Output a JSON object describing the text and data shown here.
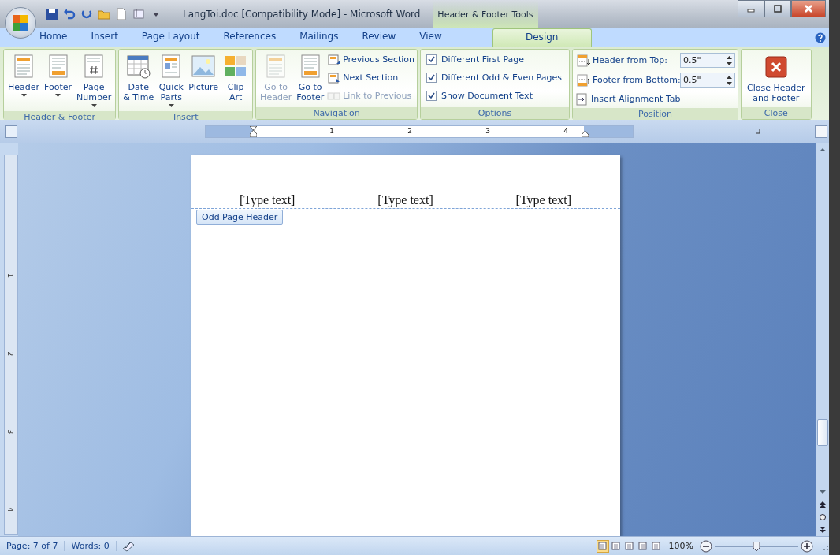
{
  "window": {
    "title": "LangToi.doc [Compatibility Mode] - Microsoft Word",
    "context_group": "Header & Footer Tools"
  },
  "tabs": [
    {
      "label": "Home",
      "selected": false
    },
    {
      "label": "Insert",
      "selected": false
    },
    {
      "label": "Page Layout",
      "selected": false
    },
    {
      "label": "References",
      "selected": false
    },
    {
      "label": "Mailings",
      "selected": false
    },
    {
      "label": "Review",
      "selected": false
    },
    {
      "label": "View",
      "selected": false
    },
    {
      "label": "Design",
      "selected": true,
      "kind": "context"
    }
  ],
  "ribbon": [
    {
      "label": "Header & Footer",
      "items": [
        {
          "kind": "large",
          "label": "Header",
          "dropdown": true,
          "disabled": false
        },
        {
          "kind": "large",
          "label": "Footer",
          "dropdown": true,
          "disabled": false
        },
        {
          "kind": "large",
          "label": "Page\nNumber",
          "dropdown": true,
          "disabled": false
        }
      ]
    },
    {
      "label": "Insert",
      "items": [
        {
          "kind": "large",
          "label": "Date\n& Time",
          "dropdown": false,
          "disabled": false
        },
        {
          "kind": "large",
          "label": "Quick\nParts",
          "dropdown": true,
          "disabled": false
        },
        {
          "kind": "large",
          "label": "Picture",
          "dropdown": false,
          "disabled": false
        },
        {
          "kind": "large",
          "label": "Clip\nArt",
          "dropdown": false,
          "disabled": false
        }
      ]
    },
    {
      "label": "Navigation",
      "items": [
        {
          "kind": "large",
          "label": "Go to\nHeader",
          "dropdown": false,
          "disabled": true
        },
        {
          "kind": "large",
          "label": "Go to\nFooter",
          "dropdown": false,
          "disabled": false
        },
        {
          "kind": "stack",
          "rows": [
            {
              "kind": "small",
              "label": "Previous Section",
              "disabled": false
            },
            {
              "kind": "small",
              "label": "Next Section",
              "disabled": false
            },
            {
              "kind": "small",
              "label": "Link to Previous",
              "disabled": true
            }
          ]
        }
      ]
    },
    {
      "label": "Options",
      "items": [
        {
          "kind": "stack",
          "rows": [
            {
              "kind": "checkbox",
              "label": "Different First Page",
              "checked": true
            },
            {
              "kind": "checkbox",
              "label": "Different Odd & Even Pages",
              "checked": true
            },
            {
              "kind": "checkbox",
              "label": "Show Document Text",
              "checked": true
            }
          ]
        }
      ]
    },
    {
      "label": "Position",
      "items": [
        {
          "kind": "stack",
          "rows": [
            {
              "kind": "spinner",
              "label": "Header from Top:",
              "value": "0.5\""
            },
            {
              "kind": "spinner",
              "label": "Footer from Bottom:",
              "value": "0.5\""
            },
            {
              "kind": "small",
              "label": "Insert Alignment Tab",
              "disabled": false
            }
          ]
        }
      ]
    },
    {
      "label": "Close",
      "items": [
        {
          "kind": "close",
          "label": "Close Header\nand Footer"
        }
      ]
    }
  ],
  "ruler": [
    "1",
    "2",
    "3",
    "4"
  ],
  "vertical_ruler": [
    "1",
    "2",
    "3",
    "4"
  ],
  "header_texts": [
    "[Type text]",
    "[Type text]",
    "[Type text]"
  ],
  "header_tag": "Odd Page Header",
  "status_bar": {
    "page": "Page: 7 of 7",
    "words": "Words: 0",
    "views": [
      {
        "selected": true
      },
      {
        "selected": false
      },
      {
        "selected": false
      },
      {
        "selected": false
      },
      {
        "selected": false
      }
    ],
    "zoom": "100%",
    "zoom_slider": {
      "level": 0.5
    }
  }
}
